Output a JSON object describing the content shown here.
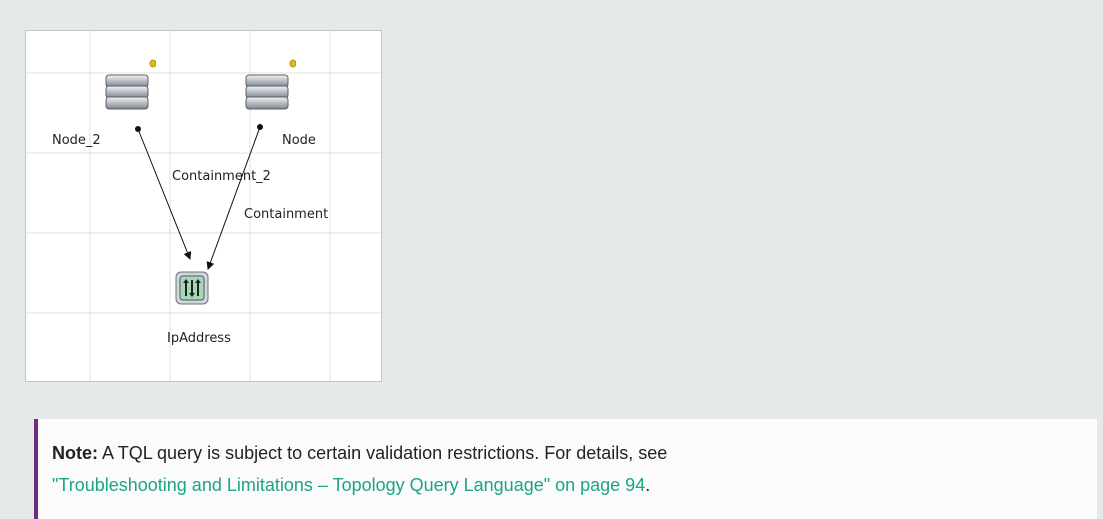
{
  "diagram": {
    "nodes": {
      "node_2": {
        "label": "Node_2",
        "icon": "server-stack-icon"
      },
      "node": {
        "label": "Node",
        "icon": "server-stack-icon"
      },
      "ip_address": {
        "label": "IpAddress",
        "icon": "ip-address-icon"
      }
    },
    "edges": {
      "containment_2": {
        "label": "Containment_2"
      },
      "containment": {
        "label": "Containment"
      }
    },
    "colors": {
      "grid": "#e1e1e1",
      "node_badge": "#e3b916",
      "ip_icon_fill": "#a9d5b9"
    }
  },
  "note": {
    "label": "Note:",
    "text": " A TQL query is subject to certain validation restrictions. For details, see",
    "link_text": "\"Troubleshooting and Limitations – Topology Query Language\" on page 94",
    "trailing": ".",
    "colors": {
      "accent": "#6e2b82",
      "link": "#1ba487"
    }
  }
}
